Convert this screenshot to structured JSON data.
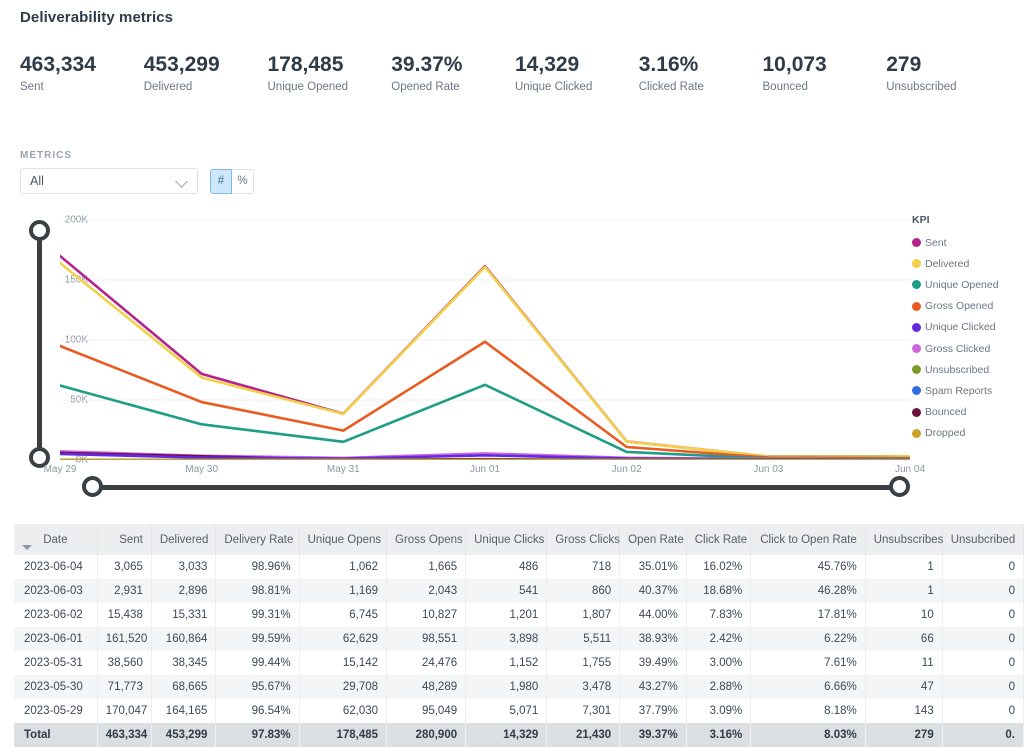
{
  "header": {
    "title": "Deliverability metrics"
  },
  "kpis": [
    {
      "value": "463,334",
      "label": "Sent"
    },
    {
      "value": "453,299",
      "label": "Delivered"
    },
    {
      "value": "178,485",
      "label": "Unique Opened"
    },
    {
      "value": "39.37%",
      "label": "Opened Rate"
    },
    {
      "value": "14,329",
      "label": "Unique Clicked"
    },
    {
      "value": "3.16%",
      "label": "Clicked Rate"
    },
    {
      "value": "10,073",
      "label": "Bounced"
    },
    {
      "value": "279",
      "label": "Unsubscribed"
    }
  ],
  "controls": {
    "metrics_caption": "METRICS",
    "select_value": "All",
    "select_icon": "chevron-down-icon",
    "unit_toggle": [
      {
        "label": "#",
        "active": true
      },
      {
        "label": "%",
        "active": false
      }
    ]
  },
  "chart_data": {
    "type": "line",
    "title": "",
    "xlabel": "",
    "ylabel": "",
    "grid": true,
    "legend_position": "right",
    "legend_title": "KPI",
    "ylim": [
      0,
      200000
    ],
    "yticks": [
      0,
      50000,
      100000,
      150000,
      200000
    ],
    "ytick_labels": [
      "0K",
      "50K",
      "100K",
      "150K",
      "200K"
    ],
    "x": [
      "May 29",
      "May 30",
      "May 31",
      "Jun 01",
      "Jun 02",
      "Jun 03",
      "Jun 04"
    ],
    "series": [
      {
        "name": "Sent",
        "color": "#b5228e",
        "values": [
          170047,
          71773,
          38560,
          161520,
          15438,
          2931,
          3065
        ]
      },
      {
        "name": "Delivered",
        "color": "#f2d149",
        "values": [
          164165,
          68665,
          38345,
          160864,
          15331,
          2896,
          3033
        ]
      },
      {
        "name": "Unique Opened",
        "color": "#1e9e84",
        "values": [
          62030,
          29708,
          15142,
          62629,
          6745,
          1169,
          1062
        ]
      },
      {
        "name": "Gross Opened",
        "color": "#ea5b20",
        "values": [
          95049,
          48289,
          24476,
          98551,
          10827,
          2043,
          1665
        ]
      },
      {
        "name": "Unique Clicked",
        "color": "#6428e0",
        "values": [
          5071,
          1980,
          1152,
          3898,
          1201,
          541,
          486
        ]
      },
      {
        "name": "Gross Clicked",
        "color": "#cc66e0",
        "values": [
          7301,
          3478,
          1755,
          5511,
          1807,
          860,
          718
        ]
      },
      {
        "name": "Unsubscribed",
        "color": "#7d9a26",
        "values": [
          143,
          47,
          11,
          66,
          10,
          1,
          1
        ]
      },
      {
        "name": "Spam Reports",
        "color": "#2f6ee0",
        "values": [
          0,
          0,
          0,
          0,
          0,
          0,
          0
        ]
      },
      {
        "name": "Bounced",
        "color": "#6d1040",
        "values": [
          5882,
          3108,
          215,
          656,
          107,
          35,
          32
        ]
      },
      {
        "name": "Dropped",
        "color": "#c9a227",
        "values": [
          0,
          0,
          0,
          0,
          0,
          0,
          0
        ]
      }
    ]
  },
  "table": {
    "columns": [
      "Date",
      "Sent",
      "Delivered",
      "Delivery Rate",
      "Unique Opens",
      "Gross Opens",
      "Unique Clicks",
      "Gross Clicks",
      "Open Rate",
      "Click Rate",
      "Click to Open Rate",
      "Unsubscribes",
      "Unsubcribed"
    ],
    "sort_column": "Date",
    "sort_direction": "descending",
    "rows": [
      [
        "2023-06-04",
        "3,065",
        "3,033",
        "98.96%",
        "1,062",
        "1,665",
        "486",
        "718",
        "35.01%",
        "16.02%",
        "45.76%",
        "1",
        "0"
      ],
      [
        "2023-06-03",
        "2,931",
        "2,896",
        "98.81%",
        "1,169",
        "2,043",
        "541",
        "860",
        "40.37%",
        "18.68%",
        "46.28%",
        "1",
        "0"
      ],
      [
        "2023-06-02",
        "15,438",
        "15,331",
        "99.31%",
        "6,745",
        "10,827",
        "1,201",
        "1,807",
        "44.00%",
        "7.83%",
        "17.81%",
        "10",
        "0"
      ],
      [
        "2023-06-01",
        "161,520",
        "160,864",
        "99.59%",
        "62,629",
        "98,551",
        "3,898",
        "5,511",
        "38.93%",
        "2.42%",
        "6.22%",
        "66",
        "0"
      ],
      [
        "2023-05-31",
        "38,560",
        "38,345",
        "99.44%",
        "15,142",
        "24,476",
        "1,152",
        "1,755",
        "39.49%",
        "3.00%",
        "7.61%",
        "11",
        "0"
      ],
      [
        "2023-05-30",
        "71,773",
        "68,665",
        "95.67%",
        "29,708",
        "48,289",
        "1,980",
        "3,478",
        "43.27%",
        "2.88%",
        "6.66%",
        "47",
        "0"
      ],
      [
        "2023-05-29",
        "170,047",
        "164,165",
        "96.54%",
        "62,030",
        "95,049",
        "5,071",
        "7,301",
        "37.79%",
        "3.09%",
        "8.18%",
        "143",
        "0"
      ]
    ],
    "total_row": [
      "Total",
      "463,334",
      "453,299",
      "97.83%",
      "178,485",
      "280,900",
      "14,329",
      "21,430",
      "39.37%",
      "3.16%",
      "8.03%",
      "279",
      "0."
    ]
  }
}
